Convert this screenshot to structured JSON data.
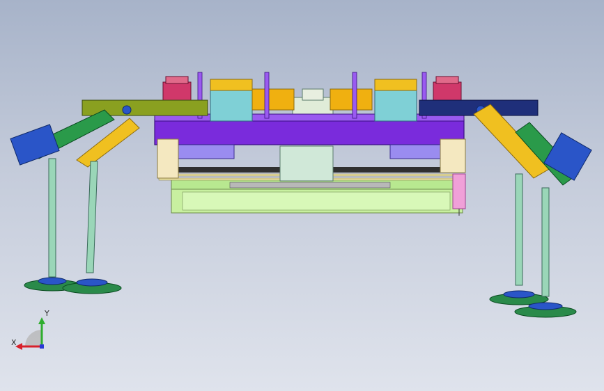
{
  "viewport": {
    "view": "front",
    "background_top": "#a7b3c9",
    "background_bottom": "#dfe3ec"
  },
  "triad": {
    "x_label": "X",
    "y_label": "Y",
    "x_color": "#d8202a",
    "y_color": "#2fae2f",
    "z_color": "#2a39d6"
  },
  "colors": {
    "frame_purple": "#7a2bdc",
    "lavender": "#9a8cf0",
    "cyan_block": "#7fd0d6",
    "yellow": "#f0c020",
    "magenta": "#d0386a",
    "navy": "#1f2f7a",
    "blue": "#2a55c8",
    "olive": "#8aa020",
    "green": "#2a9a4a",
    "leg_green": "#9ad6b8",
    "pad_green": "#2a8a4a",
    "lime_base": "#c8f0a0",
    "pink": "#f0a0d8",
    "dark_belt": "#303030"
  }
}
